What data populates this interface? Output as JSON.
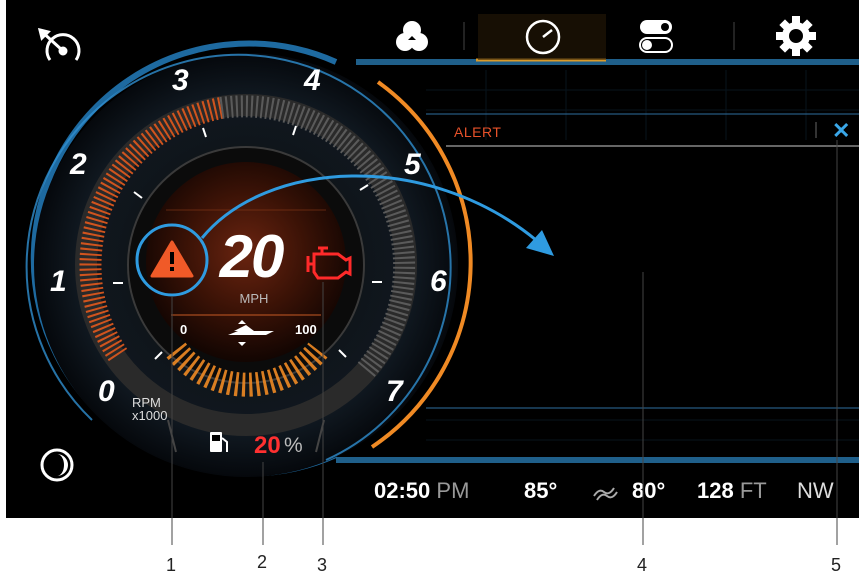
{
  "gauge": {
    "speed": "20",
    "speed_unit": "MPH",
    "rpm_numbers": [
      "0",
      "1",
      "2",
      "3",
      "4",
      "5",
      "6",
      "7"
    ],
    "rpm_unit_line1": "RPM",
    "rpm_unit_line2": "x1000",
    "trim_min": "0",
    "trim_max": "100",
    "fuel_value": "20",
    "fuel_unit": "%"
  },
  "alert_panel": {
    "title": "ALERT",
    "close_label": "✕"
  },
  "status_bar": {
    "time": "02:50",
    "ampm": "PM",
    "air_temp": "85°",
    "water_temp": "80°",
    "depth": "128",
    "depth_unit": "FT",
    "heading": "NW"
  },
  "top_icons": [
    "speedometer-icon",
    "color-theme-icon",
    "gauge-icon",
    "toggle-icon",
    "settings-gear-icon"
  ],
  "callouts": [
    "1",
    "2",
    "3",
    "4",
    "5"
  ],
  "colors": {
    "accent_blue": "#3aa7e8",
    "accent_orange": "#f08a24",
    "warning_red": "#ff3030",
    "background": "#000000"
  }
}
